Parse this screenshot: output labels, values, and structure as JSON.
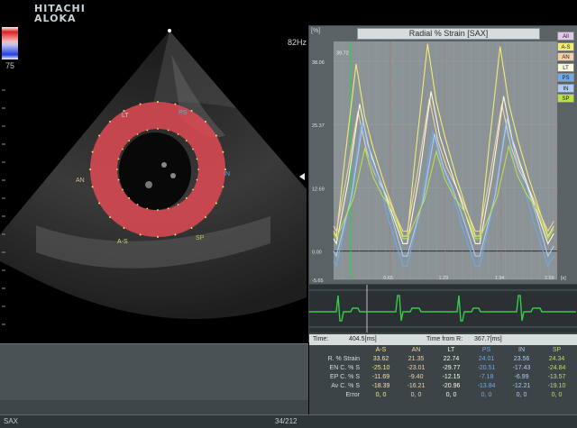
{
  "brand": {
    "line1": "HITACHI",
    "line2": "ALOKA"
  },
  "image_panel": {
    "scale_value": "75",
    "frame_rate": "82Hz",
    "segment_labels": {
      "lt": "LT",
      "ps": "PS",
      "an": "AN",
      "in": "IN",
      "as": "A-S",
      "sp": "SP"
    }
  },
  "plot": {
    "title": "Radial % Strain [SAX]",
    "unit": "[%]",
    "marker_value": "39.72",
    "y_ticks": [
      "38.06",
      "25.37",
      "12.69",
      "0.00",
      "-5.65"
    ],
    "x_ticks": [
      "0.65",
      "1.29",
      "1.94",
      "2.59"
    ],
    "x_unit": "[s]",
    "legend": [
      {
        "label": "All",
        "color": "#e2c8e8"
      },
      {
        "label": "A-S",
        "color": "#f3ec74"
      },
      {
        "label": "AN",
        "color": "#f4d0a4"
      },
      {
        "label": "LT",
        "color": "#fbfbe0"
      },
      {
        "label": "PS",
        "color": "#6fa9e8"
      },
      {
        "label": "IN",
        "color": "#aecbf2"
      },
      {
        "label": "SP",
        "color": "#b8e04a"
      }
    ]
  },
  "chart_data": {
    "type": "line",
    "title": "Radial % Strain [SAX]",
    "xlabel": "[s]",
    "ylabel": "[%]",
    "xlim": [
      0,
      2.59
    ],
    "ylim": [
      -5.65,
      42
    ],
    "series": [
      {
        "name": "A-S",
        "color": "#f3ec74",
        "peaks": [
          37.5,
          41.5,
          41.0
        ],
        "valley": 3.0
      },
      {
        "name": "AN",
        "color": "#f4d0a4",
        "peaks": [
          28.0,
          30.5,
          29.5
        ],
        "valley": 4.0
      },
      {
        "name": "LT",
        "color": "#fbfbe0",
        "peaks": [
          29.5,
          32.0,
          31.0
        ],
        "valley": 1.5
      },
      {
        "name": "PS",
        "color": "#6fa9e8",
        "peaks": [
          25.5,
          24.0,
          25.0
        ],
        "valley": -3.0
      },
      {
        "name": "IN",
        "color": "#aecbf2",
        "peaks": [
          26.0,
          23.5,
          26.5
        ],
        "valley": -1.0
      },
      {
        "name": "SP",
        "color": "#b8e04a",
        "peaks": [
          20.5,
          20.0,
          21.0
        ],
        "valley": 2.5
      }
    ]
  },
  "time_bar": {
    "time_label": "Time:",
    "time_value": "404.5[ms]",
    "from_r_label": "Time from R:",
    "from_r_value": "367.7[ms]"
  },
  "metrics": {
    "columns": [
      "A-S",
      "AN",
      "LT",
      "PS",
      "IN",
      "SP"
    ],
    "column_colors": [
      "#f3ec74",
      "#f4d0a4",
      "#fbfbe0",
      "#6fa9e8",
      "#aecbf2",
      "#b8e04a"
    ],
    "rows": [
      {
        "label": "R. % Strain",
        "values": [
          "33.62",
          "21.35",
          "22.74",
          "24.01",
          "23.56",
          "24.34"
        ]
      },
      {
        "label": "EN C. % S",
        "values": [
          "-25.10",
          "-23.01",
          "-29.77",
          "-20.51",
          "-17.43",
          "-24.84"
        ]
      },
      {
        "label": "EP C. % S",
        "values": [
          "-11.69",
          "-9.40",
          "-12.15",
          "-7.18",
          "-6.99",
          "-13.57"
        ]
      },
      {
        "label": "Av C. % S",
        "values": [
          "-18.39",
          "-16.21",
          "-20.96",
          "-13.84",
          "-12.21",
          "-19.10"
        ]
      },
      {
        "label": "Error",
        "values": [
          "0,  0",
          "0,  0",
          "0,  0",
          "0,  0",
          "0,  0",
          "0,  0"
        ]
      }
    ]
  },
  "status": {
    "mode": "SAX",
    "frame": "34/212"
  }
}
